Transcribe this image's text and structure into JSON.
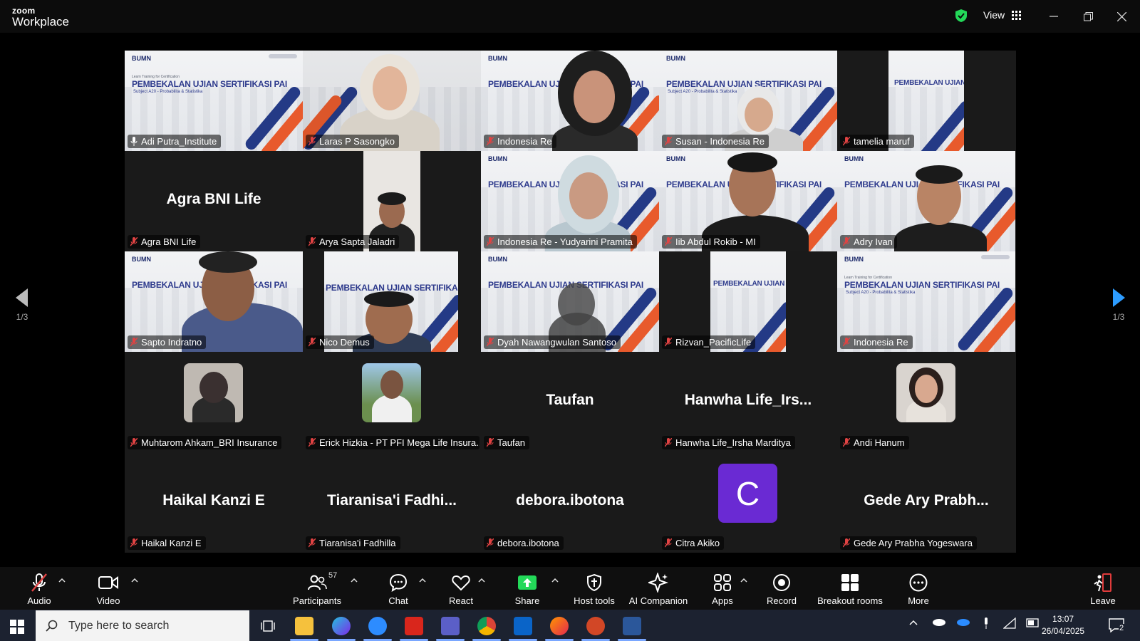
{
  "app": {
    "logo_line1": "zoom",
    "logo_line2": "Workplace",
    "view_label": "View"
  },
  "colors": {
    "active_speaker_border": "#23d959",
    "share_green": "#23d959",
    "leave_red": "#e03b3b",
    "avatar_purple": "#6a2ad3",
    "mic_muted_red": "#e04343"
  },
  "slide": {
    "brand": "BUMN",
    "caption": "Learn Training for Certification",
    "title": "PEMBEKALAN UJIAN SERTIFIKASI PAI",
    "subtitle": "Subject A20 - Probabilita & Statistika"
  },
  "gallery": {
    "row1": [
      {
        "name": "Adi Putra_Institute",
        "mic": "unmuted-icon"
      },
      {
        "name": "Laras P Sasongko",
        "mic": "muted-icon"
      },
      {
        "name": "Indonesia Re",
        "mic": "muted-icon"
      },
      {
        "name": "Susan - Indonesia Re",
        "mic": "muted-icon"
      },
      {
        "name": "tamelia maruf",
        "mic": "muted-icon"
      }
    ],
    "row2": [
      {
        "name": "Agra BNI Life",
        "big": "Agra BNI Life"
      },
      {
        "name": "Arya Sapta Jaladri"
      },
      {
        "name": "Indonesia Re - Yudyarini Pramita"
      },
      {
        "name": "Iib Abdul Rokib - MI"
      },
      {
        "name": "Adry Ivan"
      }
    ],
    "row3": [
      {
        "name": "Sapto Indratno"
      },
      {
        "name": "Nico Demus"
      },
      {
        "name": "Dyah Nawangwulan Santoso"
      },
      {
        "name": "Rizvan_PacificLife"
      },
      {
        "name": "Indonesia Re"
      }
    ],
    "row4": [
      {
        "name": "Muhtarom Ahkam_BRI Insurance"
      },
      {
        "name": "Erick Hizkia - PT PFI Mega Life Insura..."
      },
      {
        "name": "Taufan",
        "big": "Taufan"
      },
      {
        "name": "Hanwha Life_Irsha Mardityа",
        "big": "Hanwha Life_Irs..."
      },
      {
        "name": "Andi Hanum"
      }
    ],
    "row5": [
      {
        "name": "Haikal Kanzi E",
        "big": "Haikal Kanzi E"
      },
      {
        "name": "Tiaranisa'i Fadhilla",
        "big": "Tiaranisa'i Fadhi..."
      },
      {
        "name": "debora.ibotona",
        "big": "debora.ibotona"
      },
      {
        "name": "Citra Akiko",
        "initial": "C"
      },
      {
        "name": "Gede Ary Prabha Yogeswara",
        "big": "Gede Ary Prabh..."
      }
    ]
  },
  "pagination": {
    "left": "1/3",
    "right": "1/3"
  },
  "toolbar": {
    "audio": "Audio",
    "video": "Video",
    "participants": "Participants",
    "participants_count": "57",
    "chat": "Chat",
    "react": "React",
    "share": "Share",
    "host_tools": "Host tools",
    "ai_companion": "AI Companion",
    "apps": "Apps",
    "record": "Record",
    "breakout_rooms": "Breakout rooms",
    "more": "More",
    "leave": "Leave"
  },
  "taskbar": {
    "search_placeholder": "Type here to search",
    "time": "13:07",
    "date": "26/04/2025",
    "notifications": "2"
  }
}
